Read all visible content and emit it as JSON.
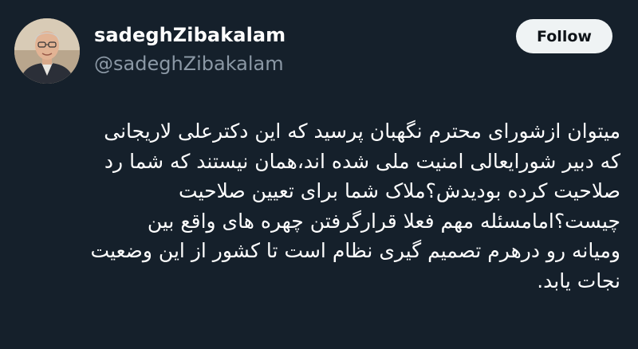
{
  "author": {
    "display_name": "sadeghZibakalam",
    "handle": "@sadeghZibakalam"
  },
  "follow_button": {
    "label": "Follow"
  },
  "tweet": {
    "lines": [
      "میتوان ازشورای محترم نگهبان پرسید که این دکترعلی لاریجانی",
      "که دبیر شورایعالی امنیت ملی شده اند،همان نیستند که شما رد",
      "صلاحیت کرده بودیدش؟ملاک شما برای تعیین صلاحیت",
      "چیست؟امامسئله مهم فعلا قرارگرفتن چهره های واقع بین",
      "ومیانه رو درهرم تصمیم گیری نظام است تا کشور از این وضعیت",
      "نجات یابد."
    ]
  },
  "colors": {
    "background": "#15202b",
    "text_primary": "#ffffff",
    "text_secondary": "#8b98a5",
    "follow_bg": "#eff3f4",
    "follow_text": "#0f1419"
  }
}
